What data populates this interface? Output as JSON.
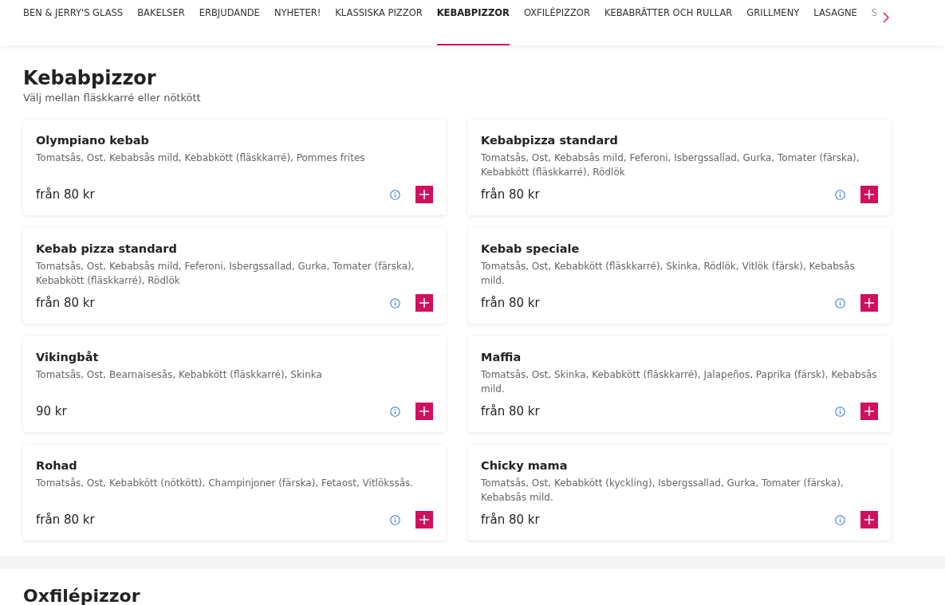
{
  "nav": {
    "tabs": [
      {
        "label": "BEN & JERRY'S GLASS",
        "selected": false
      },
      {
        "label": "BAKELSER",
        "selected": false
      },
      {
        "label": "ERBJUDANDE",
        "selected": false
      },
      {
        "label": "NYHETER!",
        "selected": false
      },
      {
        "label": "KLASSISKA PIZZOR",
        "selected": false
      },
      {
        "label": "KEBABPIZZOR",
        "selected": true
      },
      {
        "label": "OXFILÉPIZZOR",
        "selected": false
      },
      {
        "label": "KEBABRÄTTER OCH RULLAR",
        "selected": false
      },
      {
        "label": "GRILLMENY",
        "selected": false
      },
      {
        "label": "LASAGNE",
        "selected": false
      },
      {
        "label": "S",
        "selected": false
      }
    ]
  },
  "section": {
    "title": "Kebabpizzor",
    "subtitle": "Välj mellan fläskkarré eller nötkött",
    "items": [
      {
        "name": "Olympiano kebab",
        "description": "Tomatsås, Ost, Kebabsås mild, Kebabkött (fläskkarré), Pommes frites",
        "price": "från 80 kr"
      },
      {
        "name": "Kebabpizza standard",
        "description": "Tomatsås, Ost, Kebabsås mild, Feferoni, Isbergssallad, Gurka, Tomater (färska), Kebabkött (fläskkarré), Rödlök",
        "price": "från 80 kr"
      },
      {
        "name": "Kebab pizza standard",
        "description": "Tomatsås, Ost, Kebabsås mild, Feferoni, Isbergssallad, Gurka, Tomater (färska), Kebabkött (fläskkarré), Rödlök",
        "price": "från 80 kr"
      },
      {
        "name": "Kebab speciale",
        "description": "Tomatsås, Ost, Kebabkött (fläskkarré), Skinka, Rödlök, Vitlök (färsk), Kebabsås mild.",
        "price": "från 80 kr"
      },
      {
        "name": "Vikingbåt",
        "description": "Tomatsås, Ost, Bearnaisesås, Kebabkött (fläskkarré), Skinka",
        "price": "90 kr"
      },
      {
        "name": "Maffia",
        "description": "Tomatsås, Ost, Skinka, Kebabkött (fläskkarré), Jalapeños, Paprika (färsk), Kebabsås mild.",
        "price": "från 80 kr"
      },
      {
        "name": "Rohad",
        "description": "Tomatsås, Ost, Kebabkött (nötkött), Champinjoner (färska), Fetaost, Vitlökssås.",
        "price": "från 80 kr"
      },
      {
        "name": "Chicky mama",
        "description": "Tomatsås, Ost, Kebabkött (kyckling), Isbergssallad, Gurka, Tomater (färska), Kebabsås mild.",
        "price": "från 80 kr"
      }
    ]
  },
  "next_section": {
    "title": "Oxfilépizzor"
  }
}
